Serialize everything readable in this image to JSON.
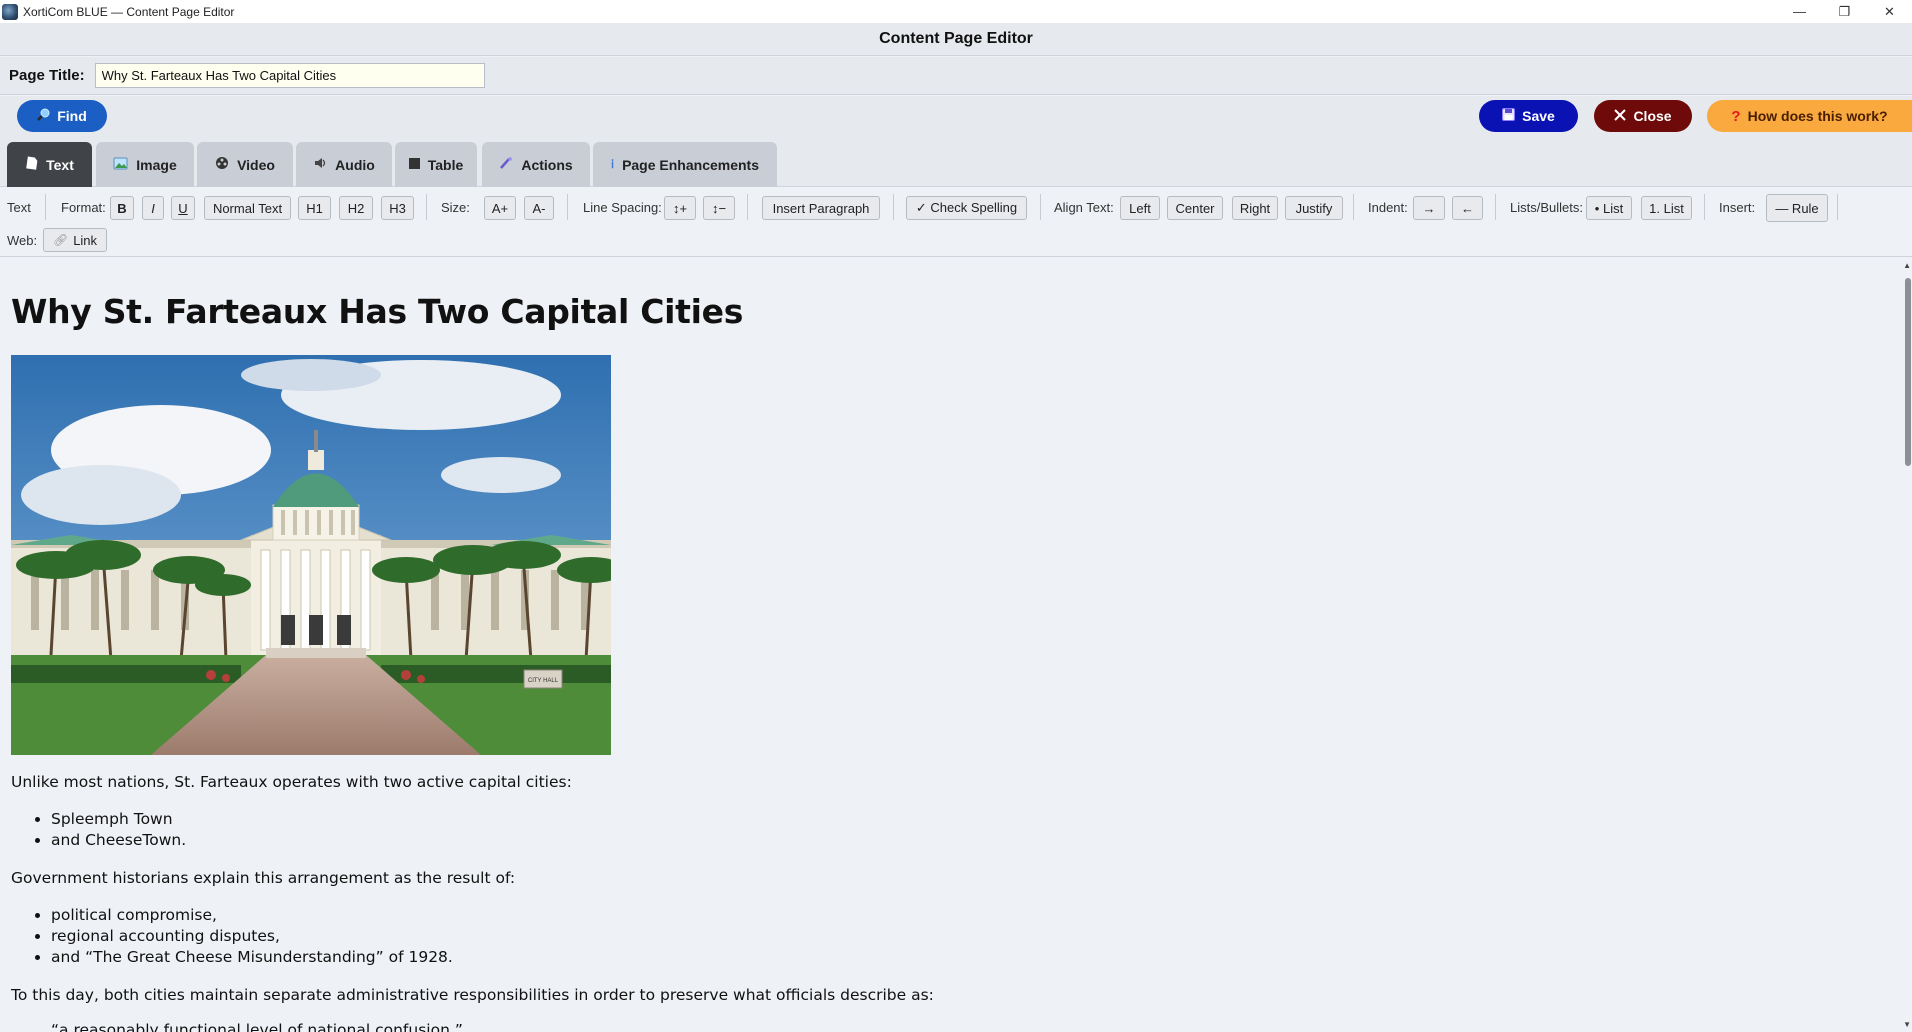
{
  "window": {
    "title": "XortiCom BLUE — Content Page Editor",
    "controls": {
      "minimize": "—",
      "restore": "❐",
      "close": "✕"
    }
  },
  "header": {
    "title": "Content Page Editor"
  },
  "page_title": {
    "label": "Page Title:",
    "value": "Why St. Farteaux Has Two Capital Cities"
  },
  "actions": {
    "find": "Find",
    "save": "Save",
    "close": "Close",
    "help": "How does this work?"
  },
  "tabs": [
    {
      "label": "Text",
      "icon": "page-icon",
      "active": true
    },
    {
      "label": "Image",
      "icon": "image-icon"
    },
    {
      "label": "Video",
      "icon": "film-icon"
    },
    {
      "label": "Audio",
      "icon": "audio-icon"
    },
    {
      "label": "Table",
      "icon": "table-icon"
    },
    {
      "label": "Actions",
      "icon": "wand-icon"
    },
    {
      "label": "Page Enhancements",
      "icon": "info-icon"
    }
  ],
  "toolbar": {
    "text_label": "Text",
    "format_label": "Format:",
    "bold": "B",
    "italic": "I",
    "underline": "U",
    "normal_text": "Normal Text",
    "h1": "H1",
    "h2": "H2",
    "h3": "H3",
    "size_label": "Size:",
    "size_up": "A+",
    "size_down": "A-",
    "line_spacing_label": "Line Spacing:",
    "spacing_up": "↕+",
    "spacing_down": "↕−",
    "insert_paragraph": "Insert Paragraph",
    "check_spelling": "✓ Check Spelling",
    "align_label": "Align Text:",
    "align_left": "Left",
    "align_center": "Center",
    "align_right": "Right",
    "align_justify": "Justify",
    "indent_label": "Indent:",
    "indent_in": "→",
    "indent_out": "←",
    "lists_label": "Lists/Bullets:",
    "bullet_list": "• List",
    "numbered_list": "1. List",
    "insert_label": "Insert:",
    "rule": "— Rule",
    "web_label": "Web:",
    "link": "Link"
  },
  "document": {
    "heading": "Why St. Farteaux Has Two Capital Cities",
    "p1": "Unlike most nations, St. Farteaux operates with two active capital cities:",
    "list1": [
      "Spleemph Town",
      "and CheeseTown."
    ],
    "p2": "Government historians explain this arrangement as the result of:",
    "list2": [
      "political compromise,",
      "regional accounting disputes,",
      "and “The Great Cheese Misunderstanding” of 1928."
    ],
    "p3": "To this day, both cities maintain separate administrative responsibilities in order to preserve what officials describe as:",
    "quote": "“a reasonably functional level of national confusion.”",
    "image_sign": "CITY HALL"
  }
}
